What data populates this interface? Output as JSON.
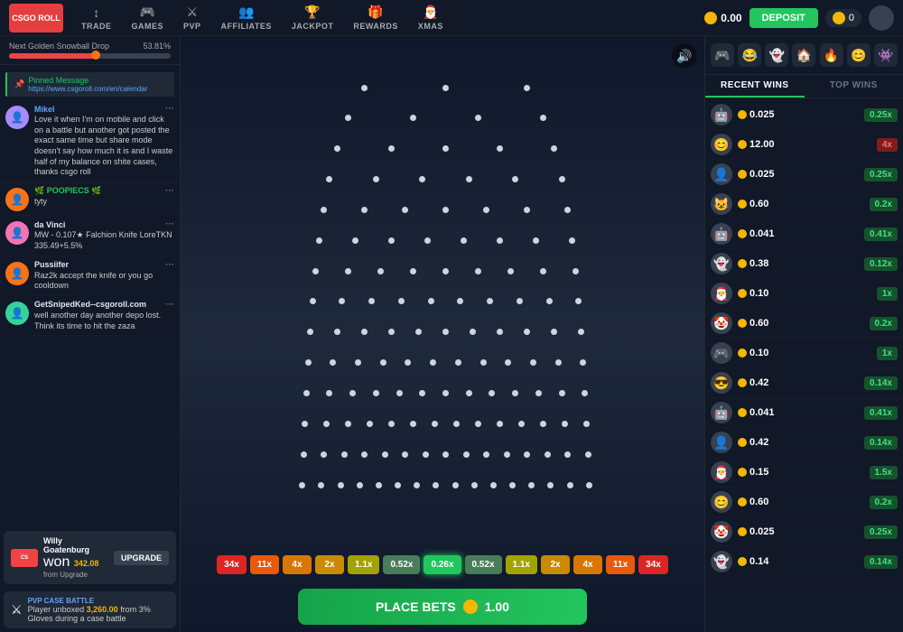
{
  "header": {
    "logo_text": "CSGO ROLL",
    "balance": "0.00",
    "deposit_label": "DEPOSIT",
    "notifications": "0",
    "nav_items": [
      {
        "icon": "↕",
        "label": "TRADE"
      },
      {
        "icon": "🎮",
        "label": "GAMES"
      },
      {
        "icon": "⚔",
        "label": "PVP"
      },
      {
        "icon": "👥",
        "label": "AFFILIATES"
      },
      {
        "icon": "🏆",
        "label": "JACKPOT"
      },
      {
        "icon": "🎁",
        "label": "REWARDS"
      },
      {
        "icon": "🎅",
        "label": "XMAS"
      }
    ]
  },
  "progress": {
    "label": "Next Golden Snowball Drop",
    "left": "0%",
    "right": "53.81%",
    "fill_pct": 53.81
  },
  "chat": {
    "pinned": {
      "text": "Pinned Message",
      "url": "https://www.csgoroll.com/en/calendar"
    },
    "messages": [
      {
        "username": "Mikel",
        "text": "Love it when I'm on mobile and click on a battle but another got posted the exact same time but share mode doesn't say how much it is and I waste half of my balance on shite cases, thanks csgo roll",
        "color": "#60a5fa"
      },
      {
        "username": "🌿 POOPIECS 🌿",
        "text": "tyty",
        "color": "#22c55e"
      },
      {
        "username": "da Vinci",
        "text": "MW - 0.107★ Falchion Knife LoreTKN 335.49+5.5%",
        "color": "#e2e8f0"
      },
      {
        "username": "Pussiifer",
        "text": "Raz2k accept the knife or you go cooldown",
        "color": "#e2e8f0"
      },
      {
        "username": "GetSnipedKed--csgoroll.com",
        "text": "well another day another depo lost. Think its time to hit the zaza",
        "color": "#e2e8f0"
      }
    ],
    "upgrade_widget": {
      "user": "Willy Goatenburg",
      "action": "won",
      "amount": "342.08",
      "from": "from Upgrade",
      "btn": "UPGRADE"
    },
    "pvp_widget": {
      "label": "PVP CASE BATTLE",
      "text": "Player unboxed",
      "amount": "3,260.00",
      "suffix": "from 3% Gloves during a case battle"
    }
  },
  "game": {
    "sound_icon": "🔊",
    "multipliers": [
      {
        "value": "34x",
        "class": "mult-34x"
      },
      {
        "value": "11x",
        "class": "mult-11x"
      },
      {
        "value": "4x",
        "class": "mult-4x"
      },
      {
        "value": "2x",
        "class": "mult-2x"
      },
      {
        "value": "1.1x",
        "class": "mult-11x-y"
      },
      {
        "value": "0.52x",
        "class": "mult-052x"
      },
      {
        "value": "0.26x",
        "class": "mult-active"
      },
      {
        "value": "0.52x",
        "class": "mult-052x"
      },
      {
        "value": "1.1x",
        "class": "mult-11x-y"
      },
      {
        "value": "2x",
        "class": "mult-2x"
      },
      {
        "value": "4x",
        "class": "mult-4x"
      },
      {
        "value": "11x",
        "class": "mult-11x"
      },
      {
        "value": "34x",
        "class": "mult-34x"
      }
    ],
    "place_bets_label": "PLACE BETS",
    "bet_amount": "1.00"
  },
  "right_panel": {
    "emojis": [
      "🎮",
      "😂",
      "👻",
      "🏠",
      "🔥",
      "😊",
      "👾"
    ],
    "tabs": [
      "RECENT WINS",
      "TOP WINS"
    ],
    "active_tab": "RECENT WINS",
    "wins": [
      {
        "avatar": "🤖",
        "amount": "0.025",
        "mult": "0.25x",
        "mult_type": "green"
      },
      {
        "avatar": "😊",
        "amount": "12.00",
        "mult": "4x",
        "mult_type": "red"
      },
      {
        "avatar": "👤",
        "amount": "0.025",
        "mult": "0.25x",
        "mult_type": "green"
      },
      {
        "avatar": "😺",
        "amount": "0.60",
        "mult": "0.2x",
        "mult_type": "green"
      },
      {
        "avatar": "🤖",
        "amount": "0.041",
        "mult": "0.41x",
        "mult_type": "green"
      },
      {
        "avatar": "👻",
        "amount": "0.38",
        "mult": "0.12x",
        "mult_type": "green"
      },
      {
        "avatar": "🎅",
        "amount": "0.10",
        "mult": "1x",
        "mult_type": "green"
      },
      {
        "avatar": "🤡",
        "amount": "0.60",
        "mult": "0.2x",
        "mult_type": "green"
      },
      {
        "avatar": "🎮",
        "amount": "0.10",
        "mult": "1x",
        "mult_type": "green"
      },
      {
        "avatar": "😎",
        "amount": "0.42",
        "mult": "0.14x",
        "mult_type": "green"
      },
      {
        "avatar": "🤖",
        "amount": "0.041",
        "mult": "0.41x",
        "mult_type": "green"
      },
      {
        "avatar": "👤",
        "amount": "0.42",
        "mult": "0.14x",
        "mult_type": "green"
      },
      {
        "avatar": "🎅",
        "amount": "0.15",
        "mult": "1.5x",
        "mult_type": "green"
      },
      {
        "avatar": "😊",
        "amount": "0.60",
        "mult": "0.2x",
        "mult_type": "green"
      },
      {
        "avatar": "🤡",
        "amount": "0.025",
        "mult": "0.25x",
        "mult_type": "green"
      },
      {
        "avatar": "👻",
        "amount": "0.14",
        "mult": "0.14x",
        "mult_type": "green"
      }
    ]
  }
}
